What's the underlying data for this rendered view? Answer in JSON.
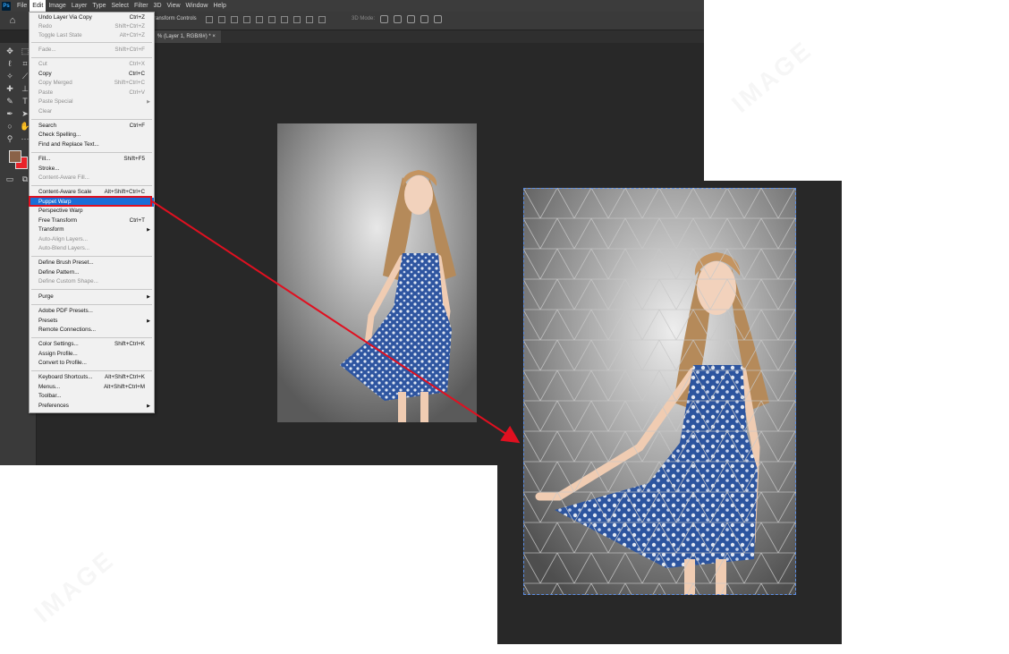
{
  "app": {
    "menubar": [
      "File",
      "Edit",
      "Image",
      "Layer",
      "Type",
      "Select",
      "Filter",
      "3D",
      "View",
      "Window",
      "Help"
    ],
    "active_menu": "Edit",
    "logo": "Ps",
    "options_bar": {
      "transform_label": "ransform Controls",
      "mode_label": "3D Mode:"
    },
    "document_tab": "% (Layer 1, RGB/8#) *"
  },
  "edit_menu": {
    "groups": [
      [
        {
          "label": "Undo Layer Via Copy",
          "shortcut": "Ctrl+Z",
          "disabled": false
        },
        {
          "label": "Redo",
          "shortcut": "Shift+Ctrl+Z",
          "disabled": true
        },
        {
          "label": "Toggle Last State",
          "shortcut": "Alt+Ctrl+Z",
          "disabled": true
        }
      ],
      [
        {
          "label": "Fade...",
          "shortcut": "Shift+Ctrl+F",
          "disabled": true
        }
      ],
      [
        {
          "label": "Cut",
          "shortcut": "Ctrl+X",
          "disabled": true
        },
        {
          "label": "Copy",
          "shortcut": "Ctrl+C",
          "disabled": false
        },
        {
          "label": "Copy Merged",
          "shortcut": "Shift+Ctrl+C",
          "disabled": true
        },
        {
          "label": "Paste",
          "shortcut": "Ctrl+V",
          "disabled": true
        },
        {
          "label": "Paste Special",
          "submenu": true,
          "disabled": true
        },
        {
          "label": "Clear",
          "disabled": true
        }
      ],
      [
        {
          "label": "Search",
          "shortcut": "Ctrl+F",
          "disabled": false
        },
        {
          "label": "Check Spelling...",
          "disabled": false
        },
        {
          "label": "Find and Replace Text...",
          "disabled": false
        }
      ],
      [
        {
          "label": "Fill...",
          "shortcut": "Shift+F5",
          "disabled": false
        },
        {
          "label": "Stroke...",
          "disabled": false
        },
        {
          "label": "Content-Aware Fill...",
          "disabled": true
        }
      ],
      [
        {
          "label": "Content-Aware Scale",
          "shortcut": "Alt+Shift+Ctrl+C",
          "disabled": false
        },
        {
          "label": "Puppet Warp",
          "disabled": false,
          "highlighted": true
        },
        {
          "label": "Perspective Warp",
          "disabled": false
        },
        {
          "label": "Free Transform",
          "shortcut": "Ctrl+T",
          "disabled": false
        },
        {
          "label": "Transform",
          "submenu": true,
          "disabled": false
        },
        {
          "label": "Auto-Align Layers...",
          "disabled": true
        },
        {
          "label": "Auto-Blend Layers...",
          "disabled": true
        }
      ],
      [
        {
          "label": "Define Brush Preset...",
          "disabled": false
        },
        {
          "label": "Define Pattern...",
          "disabled": false
        },
        {
          "label": "Define Custom Shape...",
          "disabled": true
        }
      ],
      [
        {
          "label": "Purge",
          "submenu": true,
          "disabled": false
        }
      ],
      [
        {
          "label": "Adobe PDF Presets...",
          "disabled": false
        },
        {
          "label": "Presets",
          "submenu": true,
          "disabled": false
        },
        {
          "label": "Remote Connections...",
          "disabled": false
        }
      ],
      [
        {
          "label": "Color Settings...",
          "shortcut": "Shift+Ctrl+K",
          "disabled": false
        },
        {
          "label": "Assign Profile...",
          "disabled": false
        },
        {
          "label": "Convert to Profile...",
          "disabled": false
        }
      ],
      [
        {
          "label": "Keyboard Shortcuts...",
          "shortcut": "Alt+Shift+Ctrl+K",
          "disabled": false
        },
        {
          "label": "Menus...",
          "shortcut": "Alt+Shift+Ctrl+M",
          "disabled": false
        },
        {
          "label": "Toolbar...",
          "disabled": false
        },
        {
          "label": "Preferences",
          "submenu": true,
          "disabled": false
        }
      ]
    ]
  },
  "colors": {
    "accent_highlight": "#1a6ed8",
    "annotation_red": "#e01020",
    "foreground_swatch": "#8a6248",
    "background_swatch": "#e8232a",
    "mesh_border": "#5b8ee6"
  },
  "icons": [
    "home-icon",
    "move-tool-icon",
    "marquee-tool-icon",
    "lasso-tool-icon",
    "magic-wand-icon",
    "crop-tool-icon",
    "eyedropper-icon",
    "healing-brush-icon",
    "brush-tool-icon",
    "clone-stamp-icon",
    "type-tool-icon",
    "path-selection-icon",
    "hand-tool-icon",
    "zoom-tool-icon",
    "ellipse-tool-icon",
    "more-tools-icon"
  ]
}
